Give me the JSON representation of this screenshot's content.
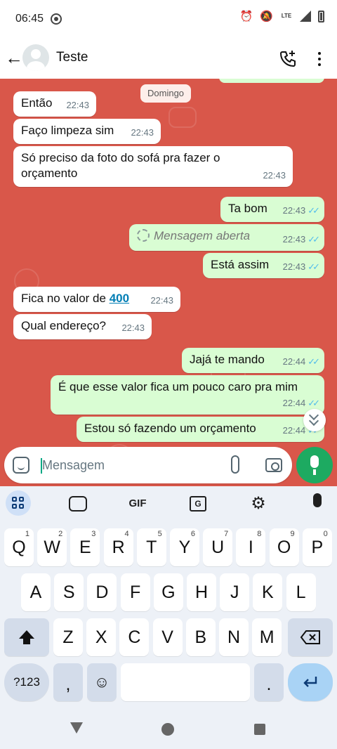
{
  "status_bar": {
    "time": "06:45",
    "network": "LTE"
  },
  "header": {
    "contact_name": "Teste"
  },
  "chat": {
    "date_chip": "Domingo",
    "messages": [
      {
        "dir": "in",
        "text": "Então",
        "time": "22:43"
      },
      {
        "dir": "in",
        "text": "Faço limpeza sim",
        "time": "22:43"
      },
      {
        "dir": "in",
        "text": "Só preciso da foto do sofá pra fazer o orçamento",
        "time": "22:43"
      },
      {
        "dir": "out",
        "text": "Ta bom",
        "time": "22:43",
        "status": "read"
      },
      {
        "dir": "out",
        "text": "Mensagem aberta",
        "time": "22:43",
        "status": "read",
        "view_once": true
      },
      {
        "dir": "out",
        "text": "Está assim",
        "time": "22:43",
        "status": "read"
      },
      {
        "dir": "in",
        "text": "Fica no valor de ",
        "link": "400",
        "time": "22:43"
      },
      {
        "dir": "in",
        "text": "Qual endereço?",
        "time": "22:43"
      },
      {
        "dir": "out",
        "text": "Jajá te mando",
        "time": "22:44",
        "status": "read"
      },
      {
        "dir": "out",
        "text": "É que esse valor fica um pouco caro pra mim",
        "time": "22:44",
        "status": "read"
      },
      {
        "dir": "out",
        "text": "Estou só fazendo um orçamento",
        "time": "22:44",
        "status": "read"
      }
    ]
  },
  "composer": {
    "placeholder": "Mensagem"
  },
  "keyboard": {
    "toolbar": {
      "gif_label": "GIF"
    },
    "row1": [
      {
        "k": "Q",
        "h": "1"
      },
      {
        "k": "W",
        "h": "2"
      },
      {
        "k": "E",
        "h": "3"
      },
      {
        "k": "R",
        "h": "4"
      },
      {
        "k": "T",
        "h": "5"
      },
      {
        "k": "Y",
        "h": "6"
      },
      {
        "k": "U",
        "h": "7"
      },
      {
        "k": "I",
        "h": "8"
      },
      {
        "k": "O",
        "h": "9"
      },
      {
        "k": "P",
        "h": "0"
      }
    ],
    "row2": [
      "A",
      "S",
      "D",
      "F",
      "G",
      "H",
      "J",
      "K",
      "L"
    ],
    "row3": [
      "Z",
      "X",
      "C",
      "V",
      "B",
      "N",
      "M"
    ],
    "symbols_label": "?123",
    "comma_label": ",",
    "period_label": ".",
    "emoji_label": "☺"
  },
  "colors": {
    "chat_bg": "#d9574a",
    "outgoing": "#d9fdd3",
    "incoming": "#ffffff",
    "mic": "#1daa61",
    "ticks": "#53bdeb"
  }
}
